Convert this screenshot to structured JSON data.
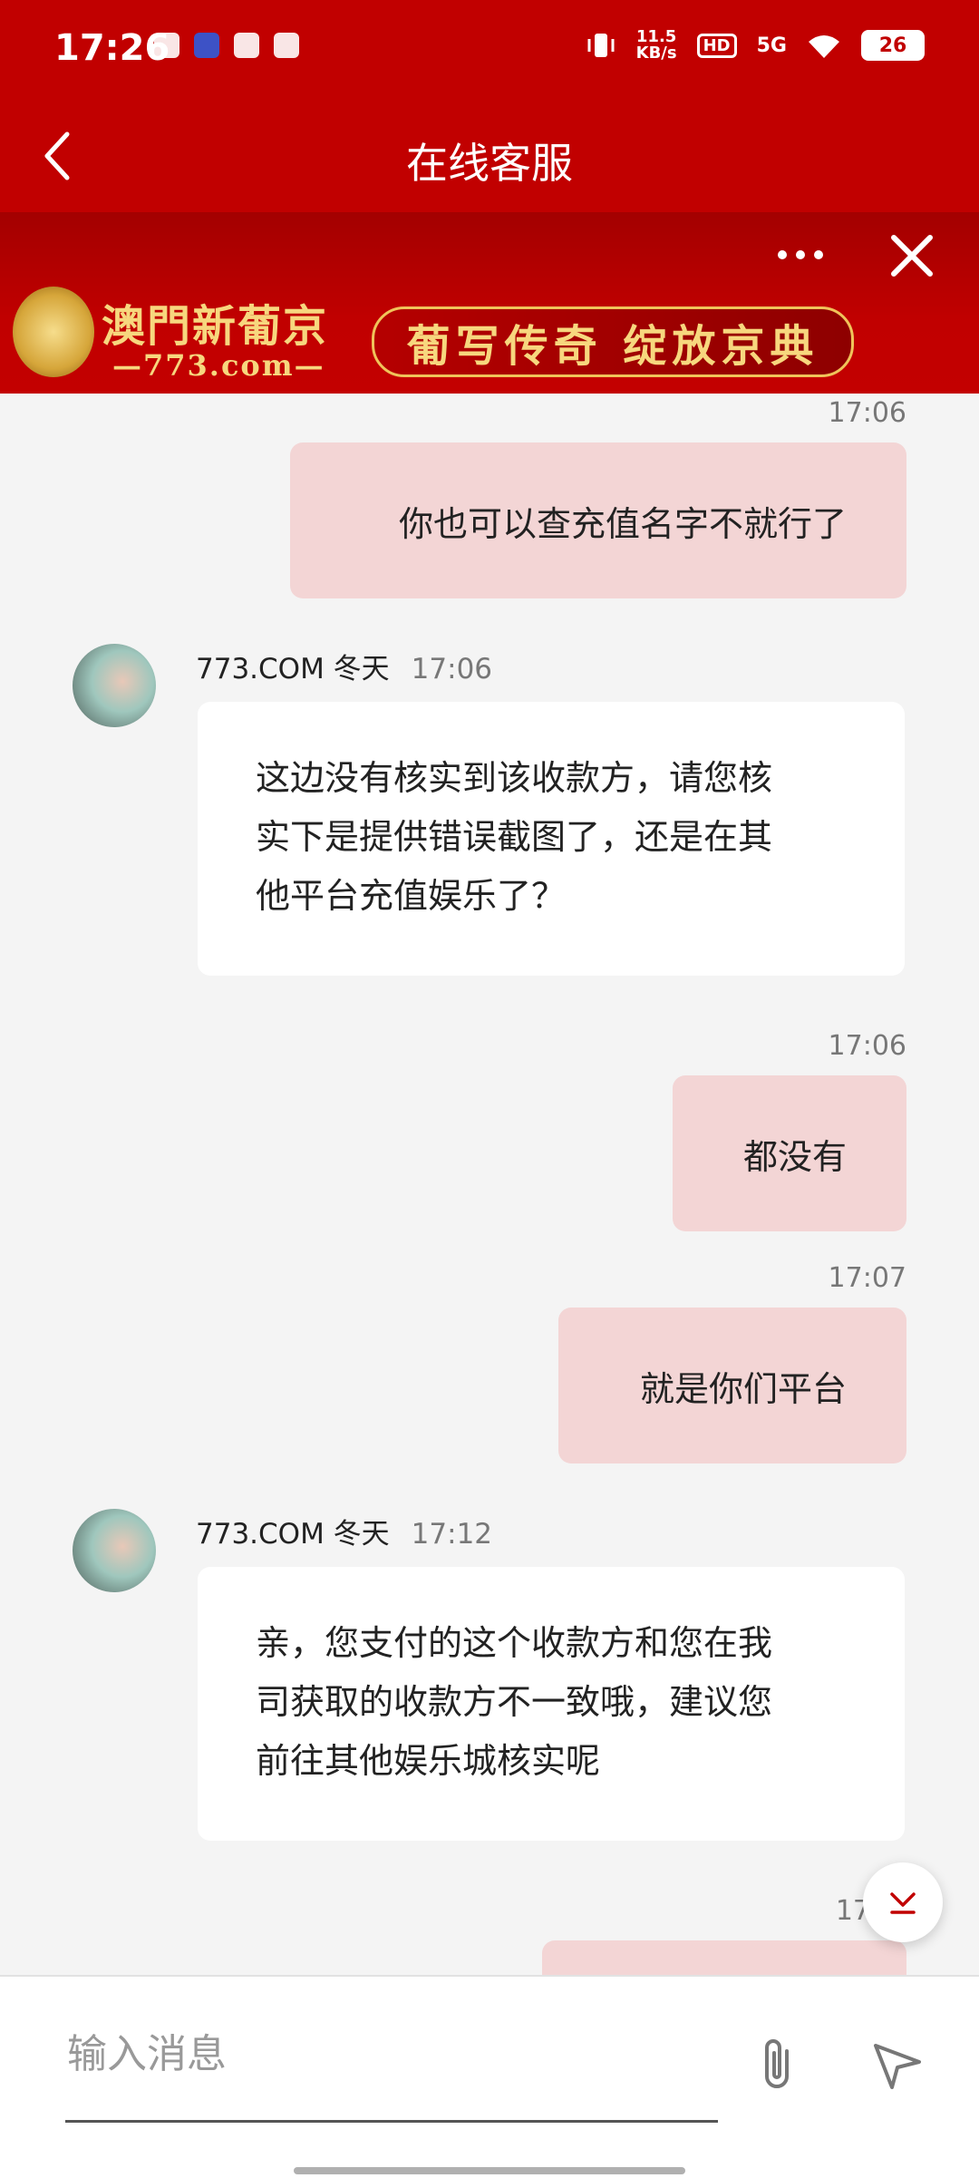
{
  "status_bar": {
    "time": "17:26",
    "speed_value": "11.5",
    "speed_unit": "KB/s",
    "hd": "HD",
    "network": "5G",
    "battery": "26"
  },
  "header": {
    "title": "在线客服"
  },
  "banner": {
    "brand_name": "澳門新葡京",
    "brand_url": "—773.com—",
    "slogan": "葡写传奇 绽放京典"
  },
  "messages": [
    {
      "type": "out",
      "time": "17:06",
      "text": "你也可以查充值名字不就行了"
    },
    {
      "type": "in",
      "sender": "773.COM 冬天",
      "time": "17:06",
      "lines": [
        "这边没有核实到该收款方，请您核",
        "实下是提供错误截图了，还是在其",
        "他平台充值娱乐了？"
      ]
    },
    {
      "type": "out",
      "time": "17:06",
      "text": "都没有"
    },
    {
      "type": "out",
      "time": "17:07",
      "text": "就是你们平台"
    },
    {
      "type": "in",
      "sender": "773.COM 冬天",
      "time": "17:12",
      "lines": [
        "亲，您支付的这个收款方和您在我",
        "司获取的收款方不一致哦，建议您",
        "前往其他娱乐城核实呢"
      ]
    },
    {
      "type": "out",
      "time": "17",
      "text": ""
    }
  ],
  "input": {
    "placeholder": "输入消息",
    "value": ""
  },
  "colors": {
    "brand_red": "#c10000",
    "outgoing_bubble": "#f3d5d5",
    "incoming_bubble": "#ffffff",
    "gold": "#f7d77e"
  },
  "icons": [
    "back-icon",
    "more-icon",
    "close-icon",
    "attach-icon",
    "send-icon",
    "chevron-down-icon"
  ]
}
